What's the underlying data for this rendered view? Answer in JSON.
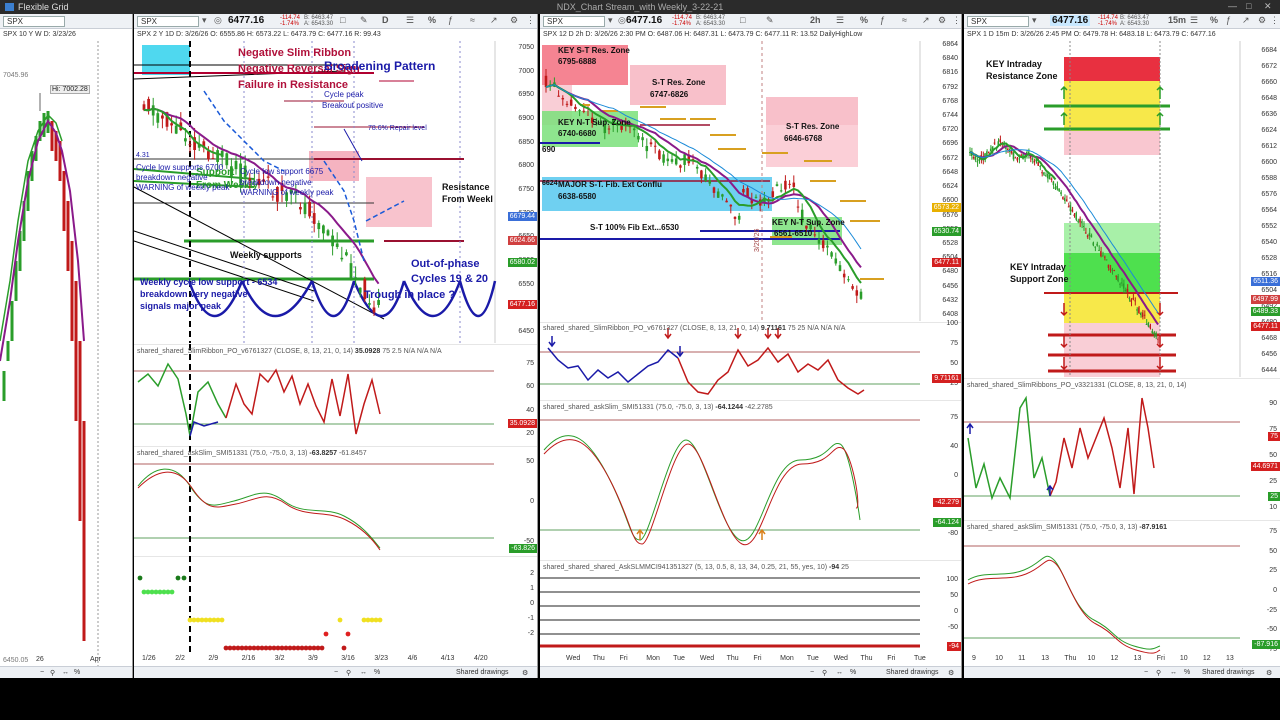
{
  "window": {
    "app_name": "Flexible Grid",
    "title": "NDX_Chart Stream_with Weekly_3-22-21"
  },
  "panel1": {
    "symbol": "SPX",
    "sub": "SPX 10 Y W   D: 3/23/26",
    "hi_label": "Hi: 7002.28",
    "price_top": "7045.96",
    "price_bottom": "6450.05",
    "x_labels": [
      "26",
      "Apr"
    ]
  },
  "panel2": {
    "symbol": "SPX",
    "price": "6477.16",
    "change": "-114.74",
    "change_pct": "-1.74%",
    "bid": "B: 6463.47",
    "ask": "A: 6543.30",
    "sub": "SPX 2 Y 1D   D: 3/26/26   O: 6555.86   H: 6573.22   L: 6473.79   C: 6477.16   R: 99.43",
    "annotations": {
      "neg_slim": "Negative Slim Ribbon",
      "neg_rev": "Negative Reversal Sign",
      "failure": "Failure in Resistance",
      "broadening": "Broadening Pattern",
      "cycle_peak": "Cycle peak",
      "breakout": "Breakout positive",
      "repair": "78.6% Repair level",
      "resistance": "Resistance",
      "from_weekly": "From Weekl",
      "support": "Support",
      "from_weekly2": "From Weekly",
      "cycle_low": "Cycle low supports 6700",
      "breakdown": "breakdown negative",
      "warning": "WARNING of weekly peak",
      "cycle_low2": "Cycle low support 6675",
      "breakdown2": "breakdown negative",
      "warning2": "WARNING of weekly peak",
      "weekly_supports": "Weekly supports",
      "out_of_phase": "Out-of-phase",
      "cycles": "Cycles 19 & 20",
      "weekly_cycle": "Weekly cycle low support - 6534",
      "breakdown3": "breakdown very negative",
      "signals": "signals major peak",
      "trough": "Trough in place ?",
      "left_val": "4.31"
    },
    "price_axis": [
      "7050",
      "7000",
      "6950",
      "6900",
      "6850",
      "6800",
      "6750",
      "6700",
      "6650",
      "6600",
      "6550",
      "6500",
      "6450"
    ],
    "tags": [
      {
        "text": "6679.44",
        "color": "#3a6fd8"
      },
      {
        "text": "6624.66",
        "color": "#d04040"
      },
      {
        "text": "6580.02",
        "color": "#2a9d2a"
      },
      {
        "text": "6477.16",
        "color": "#d42020"
      }
    ],
    "study1": {
      "name": "shared_shared_SlimRibbon_PO_v6761327 (CLOSE, 8, 13, 21, 0, 14)",
      "value": "35.0928",
      "extra": "75   2.5   N/A   N/A   N/A",
      "axis": [
        "75",
        "60",
        "40",
        "20"
      ],
      "tag": "35.0928"
    },
    "study2": {
      "name": "shared_shared_askSlim_SMI51331 (75.0, -75.0, 3, 13)",
      "v1": "-63.8257",
      "v2": "-61.8457",
      "axis": [
        "50",
        "0",
        "-50"
      ],
      "tag": "-63.826"
    },
    "study3": {
      "axis": [
        "2",
        "1",
        "0",
        "-1",
        "-2"
      ]
    },
    "x_labels": [
      "1/26",
      "2/2",
      "2/9",
      "2/16",
      "3/2",
      "3/9",
      "3/16",
      "3/23",
      "4/6",
      "4/13",
      "4/20"
    ],
    "foot": "Shared drawings"
  },
  "panel3": {
    "symbol": "SPX",
    "price": "6477.16",
    "change": "-114.74",
    "change_pct": "-1.74%",
    "bid": "B: 6463.47",
    "ask": "A: 6543.30",
    "sub": "SPX 12 D 2h   D: 3/26/26 2:30 PM   O: 6487.06   H: 6487.31   L: 6473.79   C: 6477.11   R: 13.52   DailyHighLow",
    "zones": {
      "key_st_res": "KEY S-T Res. Zone",
      "key_st_res_v": "6795-6888",
      "st_res1": "S-T Res. Zone",
      "st_res1_v": "6747-6826",
      "st_res2": "S-T Res. Zone",
      "st_res2_v": "6646-6768",
      "key_nt_sup": "KEY N-T Sup. Zone",
      "key_nt_sup_v": "6740-6680",
      "major": "MAJOR S-T. Fib. Ext Conflu",
      "major_v": "6638-6580",
      "fib100": "S-T 100% Fib Ext...6530",
      "key_nt2": "KEY N-T Sup. Zone",
      "key_nt2_v": "6561-6510",
      "left_val": "690",
      "left_val2": "6624"
    },
    "price_axis": [
      "6864",
      "6840",
      "6816",
      "6792",
      "6768",
      "6744",
      "6720",
      "6696",
      "6672",
      "6648",
      "6624",
      "6600",
      "6576",
      "6552",
      "6528",
      "6504",
      "6480",
      "6456",
      "6432",
      "6408"
    ],
    "tags": [
      {
        "text": "6573.22",
        "color": "#e8b000"
      },
      {
        "text": "6530.74",
        "color": "#2a9d2a"
      },
      {
        "text": "6477.11",
        "color": "#d42020"
      }
    ],
    "date_vertical": "3/20/26",
    "study1": {
      "name": "shared_shared_SlimRibbon_PO_v6761327 (CLOSE, 8, 13, 21, 0, 14)",
      "value": "9.71161",
      "extra": "75   25   N/A   N/A   N/A",
      "axis": [
        "100",
        "75",
        "50",
        "25"
      ],
      "tag": "9.71161"
    },
    "study2": {
      "name": "shared_shared_askSlim_SMI51331 (75.0, -75.0, 3, 13)",
      "v1": "-64.1244",
      "v2": "-42.2785",
      "axis": [
        "75",
        "40",
        "0",
        "-40",
        "-80"
      ],
      "tags": [
        "-42.279",
        "-64.124"
      ]
    },
    "study3": {
      "name": "shared_shared_shared_AskSLMMCI941351327 (5, 13, 0.5, 8, 13, 34, 0.25, 21, 55, yes, 10)",
      "value": "-94",
      "extra": "25",
      "axis": [
        "100",
        "50",
        "0",
        "-50"
      ],
      "tag": "-94"
    },
    "x_labels": [
      "Wed",
      "Thu",
      "Fri",
      "Mon",
      "Tue",
      "Wed",
      "Thu",
      "Fri",
      "Mon",
      "Tue",
      "Wed",
      "Thu",
      "Fri",
      "Tue"
    ],
    "foot": "Shared drawings"
  },
  "panel4": {
    "symbol": "SPX",
    "price": "6477.16",
    "change": "-114.74",
    "change_pct": "-1.74%",
    "bid": "B: 6463.47",
    "ask": "A: 6543.30",
    "sub": "SPX 1 D 15m   D: 3/26/26 2:45 PM   O: 6479.78   H: 6483.18   L: 6473.79   C: 6477.16",
    "zones": {
      "res": "KEY Intraday",
      "res2": "Resistance Zone",
      "sup": "KEY Intraday",
      "sup2": "Support Zone"
    },
    "price_axis": [
      "6684",
      "6672",
      "6660",
      "6648",
      "6636",
      "6624",
      "6612",
      "6600",
      "6588",
      "6576",
      "6564",
      "6552",
      "6540",
      "6528",
      "6516",
      "6504",
      "6492",
      "6480",
      "6468",
      "6456",
      "6444"
    ],
    "tags": [
      {
        "text": "6511.36",
        "color": "#3a6fd8"
      },
      {
        "text": "6497.99",
        "color": "#d04040"
      },
      {
        "text": "6489.33",
        "color": "#2a9d2a"
      },
      {
        "text": "6477.11",
        "color": "#d42020"
      }
    ],
    "study1": {
      "name": "shared_shared_SlimRibbons_PO_v3321331 (CLOSE, 8, 13, 21, 0, 14)",
      "axis": [
        "90",
        "75",
        "50",
        "25",
        "10"
      ],
      "tags": [
        "75",
        "44.6971",
        "25"
      ]
    },
    "study2": {
      "name": "shared_shared_askSlim_SMI51331 (75.0, -75.0, 3, 13)",
      "value": "-87.9161",
      "axis": [
        "75",
        "50",
        "25",
        "0",
        "-25",
        "-50",
        "-75"
      ],
      "tag": "-87.916"
    },
    "x_labels": [
      "9",
      "10",
      "11",
      "13",
      "Thu",
      "10",
      "12",
      "13",
      "Fri",
      "10",
      "12",
      "13"
    ],
    "foot": "Shared drawings"
  }
}
